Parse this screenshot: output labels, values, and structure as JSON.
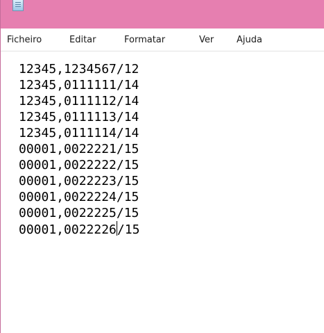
{
  "window": {
    "icon": "notepad-icon"
  },
  "menu": {
    "items": [
      "Ficheiro",
      "Editar",
      "Formatar",
      "Ver",
      "Ajuda"
    ]
  },
  "editor": {
    "lines": [
      "12345,1234567/12",
      "12345,0111111/14",
      "12345,0111112/14",
      "12345,0111113/14",
      "12345,0111114/14",
      "00001,0022221/15",
      "00001,0022222/15",
      "00001,0022223/15",
      "00001,0022224/15",
      "00001,0022225/15"
    ],
    "last_line_before_caret": "00001,0022226",
    "last_line_after_caret": "/15"
  },
  "colors": {
    "titlebar": "#e67fb0",
    "text": "#000000"
  }
}
